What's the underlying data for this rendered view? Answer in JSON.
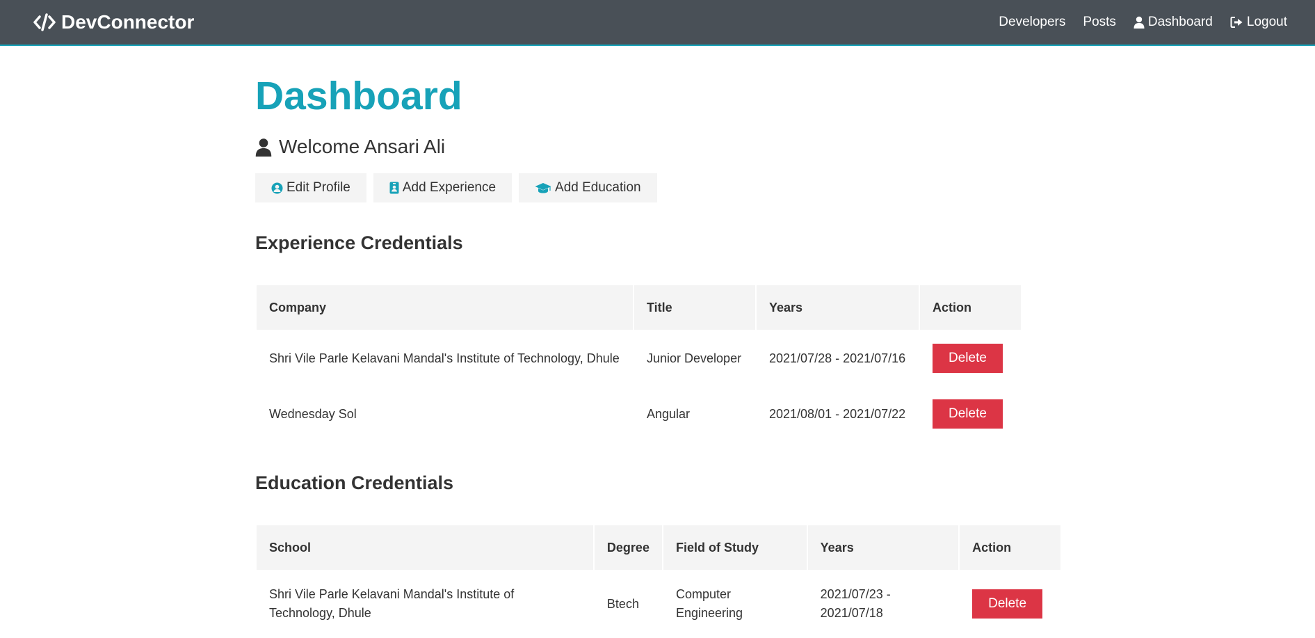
{
  "navbar": {
    "brand": "DevConnector",
    "links": [
      {
        "label": "Developers"
      },
      {
        "label": "Posts"
      },
      {
        "label": "Dashboard",
        "icon": "user-icon"
      },
      {
        "label": "Logout",
        "icon": "sign-out-icon"
      }
    ]
  },
  "page": {
    "title": "Dashboard",
    "welcome": "Welcome Ansari Ali"
  },
  "actions": {
    "edit_profile": "Edit Profile",
    "add_experience": "Add Experience",
    "add_education": "Add Education"
  },
  "experience": {
    "title": "Experience Credentials",
    "headers": [
      "Company",
      "Title",
      "Years",
      "Action"
    ],
    "rows": [
      {
        "company": "Shri Vile Parle Kelavani Mandal's Institute of Technology, Dhule",
        "title": "Junior Developer",
        "years": "2021/07/28 - 2021/07/16",
        "action": "Delete"
      },
      {
        "company": "Wednesday Sol",
        "title": "Angular",
        "years": "2021/08/01 - 2021/07/22",
        "action": "Delete"
      }
    ]
  },
  "education": {
    "title": "Education Credentials",
    "headers": [
      "School",
      "Degree",
      "Field of Study",
      "Years",
      "Action"
    ],
    "rows": [
      {
        "school": "Shri Vile Parle Kelavani Mandal's Institute of Technology, Dhule",
        "degree": "Btech",
        "field": "Computer Engineering",
        "years": "2021/07/23 - 2021/07/18",
        "action": "Delete"
      }
    ]
  },
  "colors": {
    "navbar": "#495057",
    "primary": "#17a2b8",
    "danger": "#dc3545",
    "light": "#f4f4f4"
  }
}
